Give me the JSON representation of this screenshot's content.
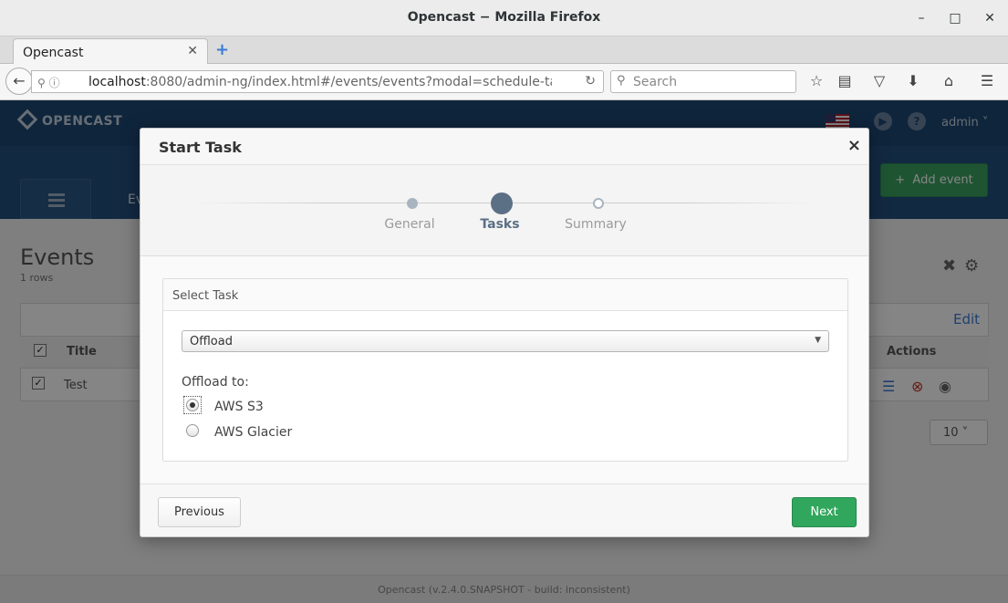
{
  "window": {
    "title": "Opencast − Mozilla Firefox",
    "minimize": "–",
    "maximize": "□",
    "close": "✕"
  },
  "tabs": [
    {
      "label": "Opencast",
      "close": "✕"
    }
  ],
  "new_tab": "+",
  "nav": {
    "url_host": "localhost",
    "url_rest": ":8080/admin-ng/index.html#/events/events?modal=schedule-task-m",
    "search_placeholder": "Search",
    "reload": "↻"
  },
  "app": {
    "brand": "OPENCAST",
    "user": "admin",
    "play_icon": "▶",
    "help_icon": "?"
  },
  "page": {
    "nav_fragment": "Ev",
    "add_event": "Add event",
    "title": "Events",
    "rows": "1 rows",
    "edit": "Edit",
    "columns": {
      "title": "Title",
      "actions": "Actions"
    },
    "row": {
      "title": "Test"
    },
    "page_size": "10",
    "footer": "Opencast (v.2.4.0.SNAPSHOT - build: inconsistent)"
  },
  "modal": {
    "title": "Start Task",
    "close": "×",
    "steps": [
      {
        "label": "General",
        "state": "done"
      },
      {
        "label": "Tasks",
        "state": "active"
      },
      {
        "label": "Summary",
        "state": "pending"
      }
    ],
    "panel_title": "Select Task",
    "task_selected": "Offload",
    "offload_label": "Offload to:",
    "options": [
      {
        "label": "AWS S3",
        "selected": true
      },
      {
        "label": "AWS Glacier",
        "selected": false
      }
    ],
    "prev_label": "Previous",
    "next_label": "Next"
  },
  "colors": {
    "accent_green": "#30a75c",
    "header_blue": "#1e4874",
    "step_active": "#5b6f85"
  }
}
